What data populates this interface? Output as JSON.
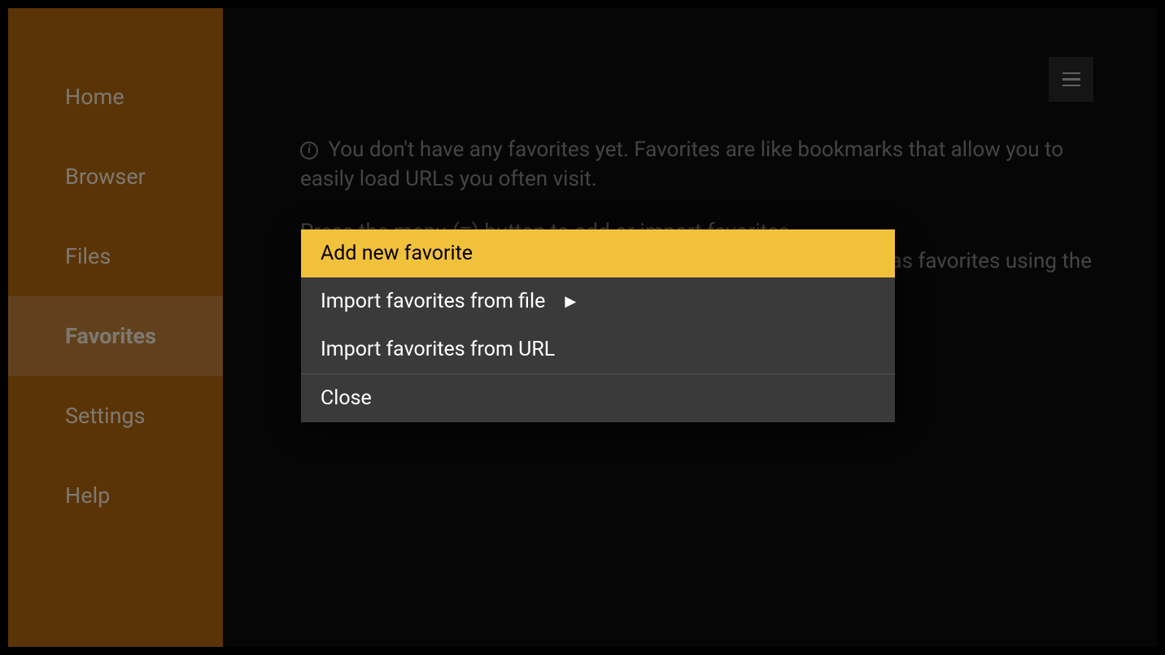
{
  "sidebar": {
    "items": [
      {
        "label": "Home"
      },
      {
        "label": "Browser"
      },
      {
        "label": "Files"
      },
      {
        "label": "Favorites"
      },
      {
        "label": "Settings"
      },
      {
        "label": "Help"
      }
    ],
    "activeIndex": 3
  },
  "main": {
    "infoText1": "You don't have any favorites yet. Favorites are like bookmarks that allow you to easily load URLs you often visit.",
    "infoText2": "Press the menu (≡) button to add or import favorites.",
    "infoText3Partial": "as favorites using the"
  },
  "popup": {
    "items": [
      {
        "label": "Add new favorite",
        "highlighted": true,
        "hasSubmenu": false
      },
      {
        "label": "Import favorites from file",
        "highlighted": false,
        "hasSubmenu": true
      },
      {
        "label": "Import favorites from URL",
        "highlighted": false,
        "hasSubmenu": false
      },
      {
        "label": "Close",
        "highlighted": false,
        "hasSubmenu": false,
        "divider": true
      }
    ],
    "submenuArrow": "▶"
  }
}
